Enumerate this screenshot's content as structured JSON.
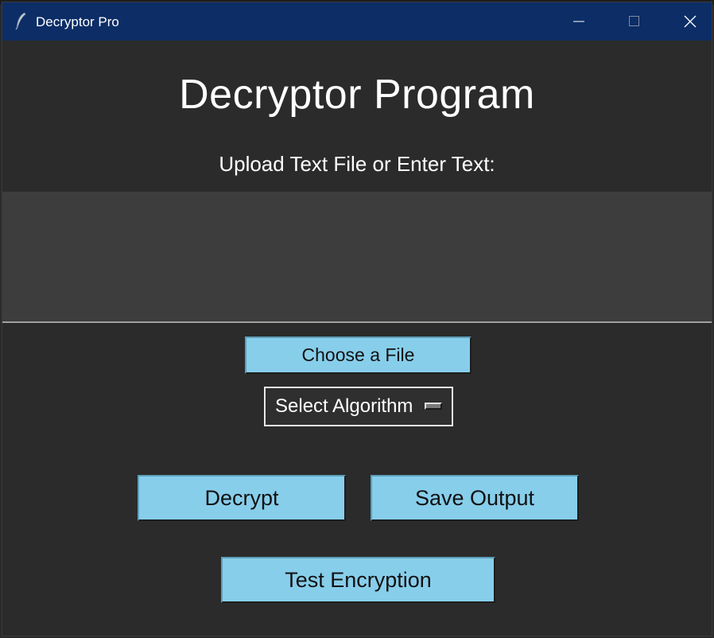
{
  "window": {
    "title": "Decryptor Pro",
    "titlebar_color": "#0c2d66",
    "app_icon": "feather-icon",
    "controls": {
      "minimize_icon": "minimize-icon",
      "maximize_icon": "maximize-icon",
      "close_icon": "close-icon"
    }
  },
  "main": {
    "heading": "Decryptor Program",
    "instruction": "Upload Text File or Enter Text:",
    "text_input": {
      "value": "",
      "placeholder": ""
    },
    "choose_file_label": "Choose a File",
    "algorithm_select": {
      "selected": "Select Algorithm"
    },
    "decrypt_label": "Decrypt",
    "save_output_label": "Save Output",
    "test_encryption_label": "Test Encryption"
  },
  "colors": {
    "background": "#2b2b2b",
    "text_area": "#3d3d3d",
    "button": "#87ceeb",
    "text": "#ffffff"
  }
}
